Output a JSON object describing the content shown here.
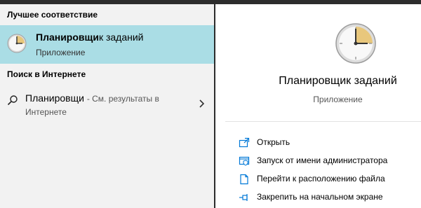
{
  "left": {
    "best_match_title": "Лучшее соответствие",
    "best_match": {
      "name_prefix": "Планировщи",
      "name_rest": "к заданий",
      "type": "Приложение",
      "icon": "clock-icon"
    },
    "web_search_title": "Поиск в Интернете",
    "web_item": {
      "query": "Планировщи",
      "hint": "- См. результаты в Интернете",
      "icon": "search-icon"
    }
  },
  "right": {
    "app_name": "Планировщик заданий",
    "app_type": "Приложение",
    "actions": [
      {
        "label": "Открыть",
        "icon": "open-icon"
      },
      {
        "label": "Запуск от имени администратора",
        "icon": "shield-icon"
      },
      {
        "label": "Перейти к расположению файла",
        "icon": "file-location-icon"
      },
      {
        "label": "Закрепить на начальном экране",
        "icon": "pin-icon"
      }
    ]
  },
  "colors": {
    "selection": "#aadde5",
    "accent": "#0078d7",
    "clock_face_highlight": "#e8c77c"
  }
}
